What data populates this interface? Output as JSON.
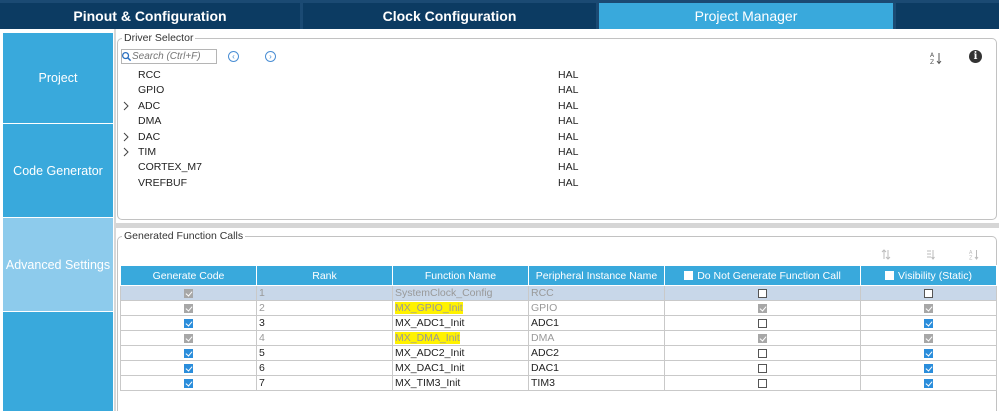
{
  "tabs": [
    {
      "label": "Pinout & Configuration"
    },
    {
      "label": "Clock Configuration"
    },
    {
      "label": "Project Manager"
    },
    {
      "label": ""
    }
  ],
  "nav": [
    {
      "label": "Project"
    },
    {
      "label": "Code Generator"
    },
    {
      "label": "Advanced Settings"
    },
    {
      "label": ""
    }
  ],
  "driver_selector": {
    "title": "Driver Selector",
    "search_placeholder": "Search (Ctrl+F)",
    "rows": [
      {
        "name": "RCC",
        "value": "HAL",
        "expandable": false
      },
      {
        "name": "GPIO",
        "value": "HAL",
        "expandable": false
      },
      {
        "name": "ADC",
        "value": "HAL",
        "expandable": true
      },
      {
        "name": "DMA",
        "value": "HAL",
        "expandable": false
      },
      {
        "name": "DAC",
        "value": "HAL",
        "expandable": true
      },
      {
        "name": "TIM",
        "value": "HAL",
        "expandable": true
      },
      {
        "name": "CORTEX_M7",
        "value": "HAL",
        "expandable": false
      },
      {
        "name": "VREFBUF",
        "value": "HAL",
        "expandable": false
      }
    ]
  },
  "generated_calls": {
    "title": "Generated Function Calls",
    "columns": [
      "Generate Code",
      "Rank",
      "Function Name",
      "Peripheral Instance Name",
      "Do Not Generate Function Call",
      "Visibility (Static)"
    ],
    "rows": [
      {
        "rank": "1",
        "function": "SystemClock_Config",
        "instance": "RCC",
        "generate": "gray",
        "no_call": "off",
        "visibility": "off",
        "state": "selected",
        "highlight": false
      },
      {
        "rank": "2",
        "function": "MX_GPIO_Init",
        "instance": "GPIO",
        "generate": "gray",
        "no_call": "gray",
        "visibility": "gray",
        "state": "disabled",
        "highlight": true
      },
      {
        "rank": "3",
        "function": "MX_ADC1_Init",
        "instance": "ADC1",
        "generate": "on",
        "no_call": "off",
        "visibility": "on",
        "state": "normal",
        "highlight": false
      },
      {
        "rank": "4",
        "function": "MX_DMA_Init",
        "instance": "DMA",
        "generate": "gray",
        "no_call": "gray",
        "visibility": "gray",
        "state": "disabled",
        "highlight": true
      },
      {
        "rank": "5",
        "function": "MX_ADC2_Init",
        "instance": "ADC2",
        "generate": "on",
        "no_call": "off",
        "visibility": "on",
        "state": "normal",
        "highlight": false
      },
      {
        "rank": "6",
        "function": "MX_DAC1_Init",
        "instance": "DAC1",
        "generate": "on",
        "no_call": "off",
        "visibility": "on",
        "state": "normal",
        "highlight": false
      },
      {
        "rank": "7",
        "function": "MX_TIM3_Init",
        "instance": "TIM3",
        "generate": "on",
        "no_call": "off",
        "visibility": "on",
        "state": "normal",
        "highlight": false
      }
    ]
  },
  "colors": {
    "tab_dark": "#0c3b62",
    "tab_active": "#39a9dc",
    "nav_selected": "#8dcbec",
    "highlight": "#fff200",
    "checkbox_on": "#2a8ddb"
  },
  "icons": [
    "search-icon",
    "arrow-left-circle-icon",
    "arrow-right-circle-icon",
    "sort-alpha-icon",
    "info-icon",
    "chevron-right-icon",
    "sort-up-icon",
    "sort-down-icon"
  ]
}
